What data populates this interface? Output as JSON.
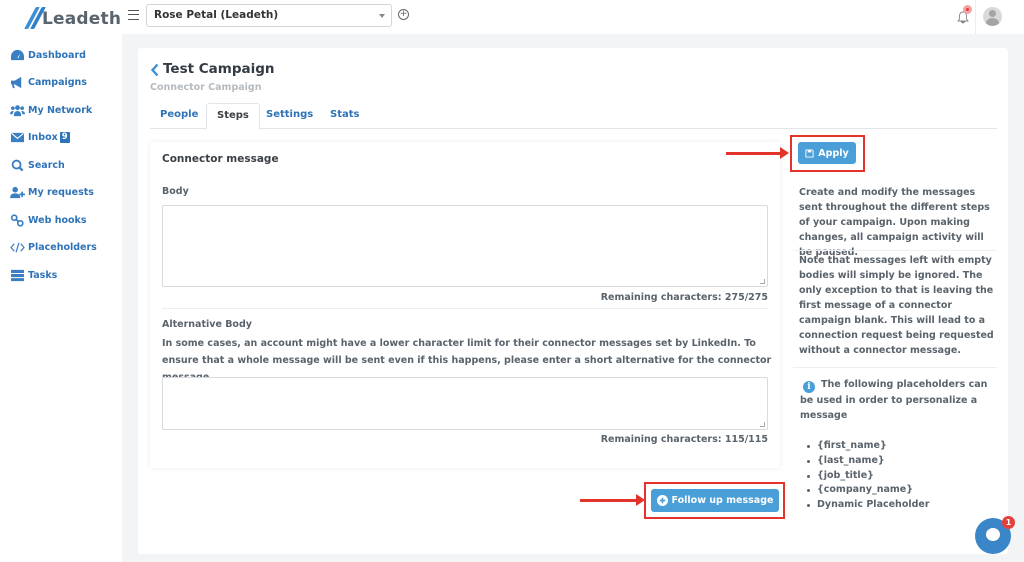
{
  "brand": {
    "name": "Leadeth",
    "accent": "#2e73b8",
    "button_color": "#4a9fd8",
    "highlight_color": "#e4332b"
  },
  "topbar": {
    "account_selected": "Rose Petal (Leadeth)",
    "menu_icon": "hamburger-icon",
    "add_icon": "plus-circle-icon",
    "notification_icon": "bell-icon",
    "avatar_icon": "user-avatar-icon"
  },
  "sidebar": {
    "items": [
      {
        "label": "Dashboard",
        "icon": "dashboard-gauge-icon"
      },
      {
        "label": "Campaigns",
        "icon": "megaphone-icon"
      },
      {
        "label": "My Network",
        "icon": "users-icon"
      },
      {
        "label": "Inbox",
        "icon": "envelope-icon",
        "badge": "9"
      },
      {
        "label": "Search",
        "icon": "search-icon"
      },
      {
        "label": "My requests",
        "icon": "user-plus-icon"
      },
      {
        "label": "Web hooks",
        "icon": "link-icon"
      },
      {
        "label": "Placeholders",
        "icon": "code-icon"
      },
      {
        "label": "Tasks",
        "icon": "tasks-icon"
      }
    ]
  },
  "page": {
    "title": "Test Campaign",
    "subtitle": "Connector Campaign",
    "tabs": [
      {
        "label": "People",
        "active": false
      },
      {
        "label": "Steps",
        "active": true
      },
      {
        "label": "Settings",
        "active": false
      },
      {
        "label": "Stats",
        "active": false
      }
    ]
  },
  "connector": {
    "title": "Connector message",
    "body_label": "Body",
    "body_value": "",
    "body_remaining": "Remaining characters: 275/275",
    "alt_label": "Alternative Body",
    "alt_help": "In some cases, an account might have a lower character limit for their connector messages set by LinkedIn. To ensure that a whole message will be sent even if this happens, please enter a short alternative for the connector message.",
    "alt_value": "",
    "alt_remaining": "Remaining characters: 115/115"
  },
  "actions": {
    "apply_label": "Apply",
    "follow_up_label": "Follow up message"
  },
  "aside": {
    "para1": "Create and modify the messages sent throughout the different steps of your campaign. Upon making changes, all campaign activity will be paused.",
    "para2": "Note that messages left with empty bodies will simply be ignored. The only exception to that is leaving the first message of a connector campaign blank. This will lead to a connection request being requested without a connector message.",
    "placeholders_intro": "The following placeholders can be used in order to personalize a message",
    "placeholders": [
      "{first_name}",
      "{last_name}",
      "{job_title}",
      "{company_name}",
      "Dynamic Placeholder"
    ]
  },
  "chat": {
    "unread": "1"
  }
}
